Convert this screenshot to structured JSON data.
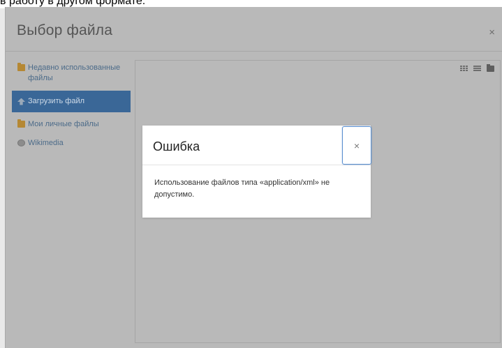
{
  "background": {
    "partial_text": "в работу в другом формате."
  },
  "picker": {
    "title": "Выбор файла",
    "close_glyph": "×",
    "sidebar_items": [
      {
        "label": "Недавно использованные файлы",
        "icon": "folder-icon",
        "active": false
      },
      {
        "label": "Загрузить файл",
        "icon": "upload-icon",
        "active": true
      },
      {
        "label": "Мои личные файлы",
        "icon": "folder-icon",
        "active": false
      },
      {
        "label": "Wikimedia",
        "icon": "globe-icon",
        "active": false
      }
    ],
    "view_icons": [
      "grid-view-icon",
      "list-view-icon",
      "folder-view-icon"
    ],
    "colors": {
      "active_item_bg": "#3a6797",
      "overlay_bg": "#b9b9b9"
    }
  },
  "modal": {
    "title": "Ошибка",
    "close_glyph": "×",
    "message": "Использование файлов типа «application/xml» не допустимо.",
    "colors": {
      "focus_ring": "#5a8fd0"
    }
  }
}
